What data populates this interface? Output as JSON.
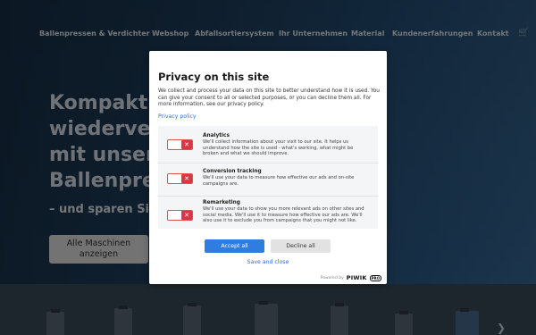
{
  "nav": {
    "items": [
      "Ballenpressen & Verdichter",
      "Webshop",
      "Abfallsortiersystem",
      "Ihr Unternehmen",
      "Material",
      "Kundenerfahrungen",
      "Kontakt"
    ]
  },
  "hero": {
    "headline_lines": [
      "Kompaktier",
      "wiederverw",
      "mit unseren",
      "Ballenpress"
    ],
    "subline": "– und sparen Sie Z",
    "all_machines_button": "Alle Maschinen anzeigen"
  },
  "modal": {
    "title": "Privacy on this site",
    "description": "We collect and process your data on this site to better understand how it is used. You can give your consent to all or selected purposes, or you can decline them all. For more information, see our privacy policy.",
    "policy_link": "Privacy policy",
    "categories": [
      {
        "name": "Analytics",
        "description": "We'll collect information about your visit to our site. It helps us understand how the site is used - what's working, what might be broken and what we should improve.",
        "enabled": false
      },
      {
        "name": "Conversion tracking",
        "description": "We'll use your data to measure how effective our ads and on-site campaigns are.",
        "enabled": false
      },
      {
        "name": "Remarketing",
        "description": "We'll use your data to show you more relevant ads on other sites and social media. We'll use it to measure how effective our ads are. We'll also use it to exclude you from campaigns that you might not like.",
        "enabled": false
      }
    ],
    "accept_label": "Accept all",
    "decline_label": "Decline all",
    "save_label": "Save and close",
    "powered_by": "Powered by",
    "brand": "PIWIK",
    "brand_badge": "PRO"
  },
  "colors": {
    "accent": "#2f7de1",
    "toggle_off": "#dc3545"
  }
}
